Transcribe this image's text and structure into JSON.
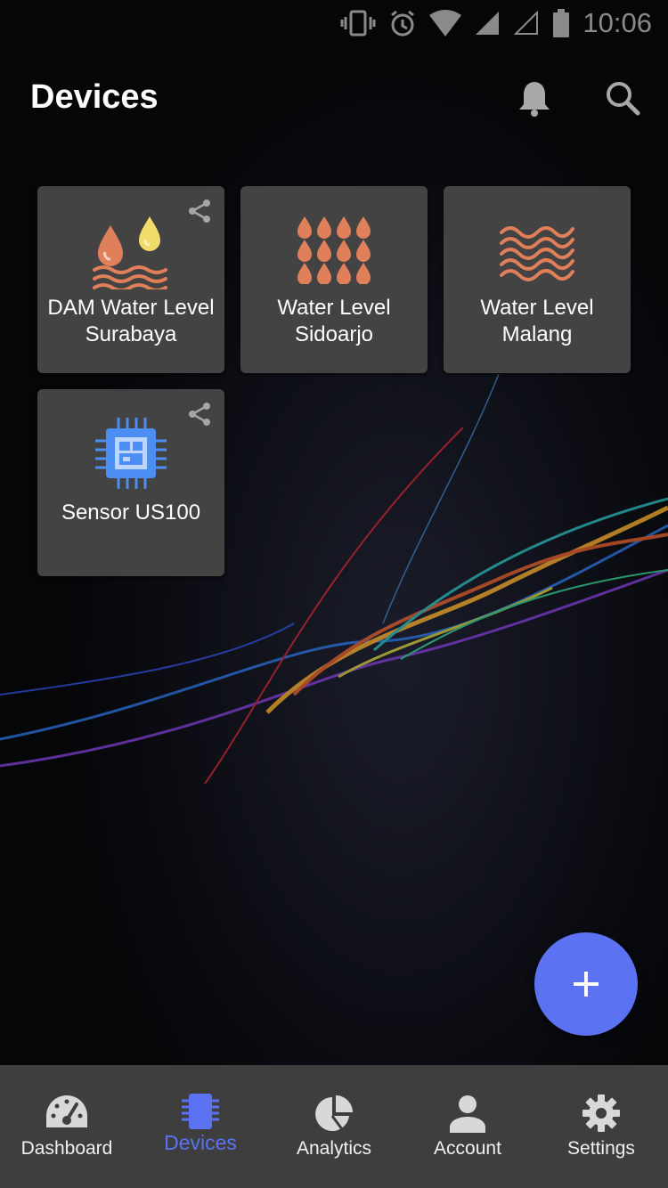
{
  "status_bar": {
    "time": "10:06",
    "icons": [
      "vibrate-icon",
      "alarm-icon",
      "wifi-icon",
      "signal-icon",
      "signal-empty-icon",
      "battery-icon"
    ]
  },
  "header": {
    "title": "Devices",
    "icons": [
      "bell-icon",
      "search-icon"
    ]
  },
  "devices": [
    {
      "name": "DAM Water Level Surabaya",
      "icon": "water-drops-waves-icon",
      "shared": true
    },
    {
      "name": "Water Level Sidoarjo",
      "icon": "rain-drops-icon",
      "shared": false
    },
    {
      "name": "Water Level Malang",
      "icon": "waves-icon",
      "shared": false
    },
    {
      "name": "Sensor US100",
      "icon": "chip-icon",
      "shared": true
    }
  ],
  "fab": {
    "icon": "plus-icon"
  },
  "bottom_nav": {
    "items": [
      {
        "label": "Dashboard",
        "icon": "gauge-icon"
      },
      {
        "label": "Devices",
        "icon": "chip-icon"
      },
      {
        "label": "Analytics",
        "icon": "pie-chart-icon"
      },
      {
        "label": "Account",
        "icon": "user-icon"
      },
      {
        "label": "Settings",
        "icon": "gear-icon"
      }
    ],
    "active": "Devices"
  },
  "colors": {
    "accent": "#5b72f2",
    "tile": "#434343",
    "nav": "#3e3e3e",
    "drop": "#e0805a",
    "drop_yellow": "#f1db6a"
  }
}
